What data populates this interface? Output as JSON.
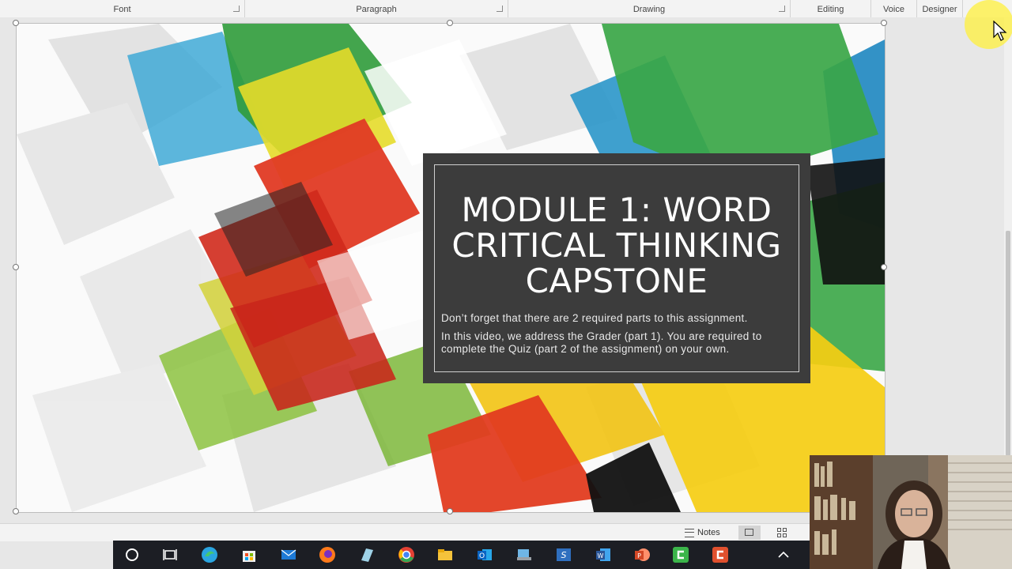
{
  "ribbon": {
    "groups": [
      {
        "label": "Font"
      },
      {
        "label": "Paragraph"
      },
      {
        "label": "Drawing"
      },
      {
        "label": "Editing"
      },
      {
        "label": "Voice"
      },
      {
        "label": "Designer"
      }
    ]
  },
  "slide": {
    "title": "MODULE 1: WORD CRITICAL THINKING CAPSTONE",
    "subtitle_lines": [
      "Don’t forget that there are 2 required parts to this assignment.",
      "In this video, we address the Grader (part 1).  You are required to complete the Quiz (part 2 of the assignment) on your own."
    ]
  },
  "statusbar": {
    "notes_label": "Notes",
    "views": [
      {
        "icon": "normal-view-icon",
        "active": true
      },
      {
        "icon": "slide-sorter-icon",
        "active": false
      }
    ]
  },
  "taskbar": {
    "apps": [
      {
        "name": "search-icon",
        "color": "#ffffff"
      },
      {
        "name": "task-view-icon",
        "color": "#ffffff"
      },
      {
        "name": "edge-icon",
        "color": "#2aa5e0"
      },
      {
        "name": "store-icon",
        "color": "#f0f0f0"
      },
      {
        "name": "mail-icon",
        "color": "#1e7ad6"
      },
      {
        "name": "firefox-icon",
        "color": "#ff7a1a"
      },
      {
        "name": "app-icon",
        "color": "#9fd3e8"
      },
      {
        "name": "chrome-icon",
        "color": "#e44134"
      },
      {
        "name": "file-explorer-icon",
        "color": "#f5c33b"
      },
      {
        "name": "outlook-icon",
        "color": "#0a64c2"
      },
      {
        "name": "snipping-icon",
        "color": "#6fb6e6"
      },
      {
        "name": "sharepoint-icon",
        "color": "#2f6fbf"
      },
      {
        "name": "word-icon",
        "color": "#2b579a"
      },
      {
        "name": "powerpoint-icon",
        "color": "#d24726"
      },
      {
        "name": "camtasia-icon",
        "color": "#3bb54a"
      },
      {
        "name": "recorder-icon",
        "color": "#e0502e"
      }
    ]
  },
  "colors": {
    "title_box": "#3c3c3c",
    "title_text": "#ffffff",
    "ribbon_bg": "#f3f3f3",
    "taskbar_bg": "#1c1e24"
  }
}
